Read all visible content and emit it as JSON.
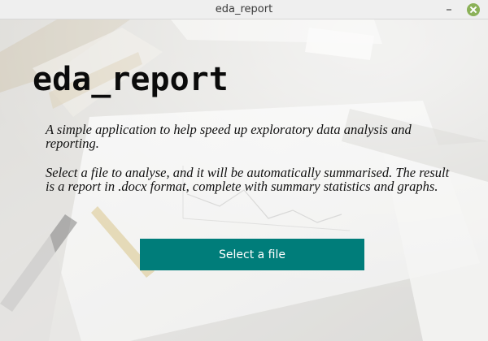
{
  "window": {
    "title": "eda_report"
  },
  "main": {
    "heading": "eda_report",
    "description_1": "A simple application to help speed up exploratory data analysis and reporting.",
    "description_2": "Select a file to analyse, and it will be automatically summarised. The result is a report in .docx format, complete with summary statistics and graphs.",
    "select_button_label": "Select a file"
  },
  "colors": {
    "button_background": "#007d7a",
    "close_button": "#8bb158",
    "titlebar": "#efefef"
  },
  "icons": {
    "minimize": "minimize-icon",
    "close": "close-icon"
  }
}
